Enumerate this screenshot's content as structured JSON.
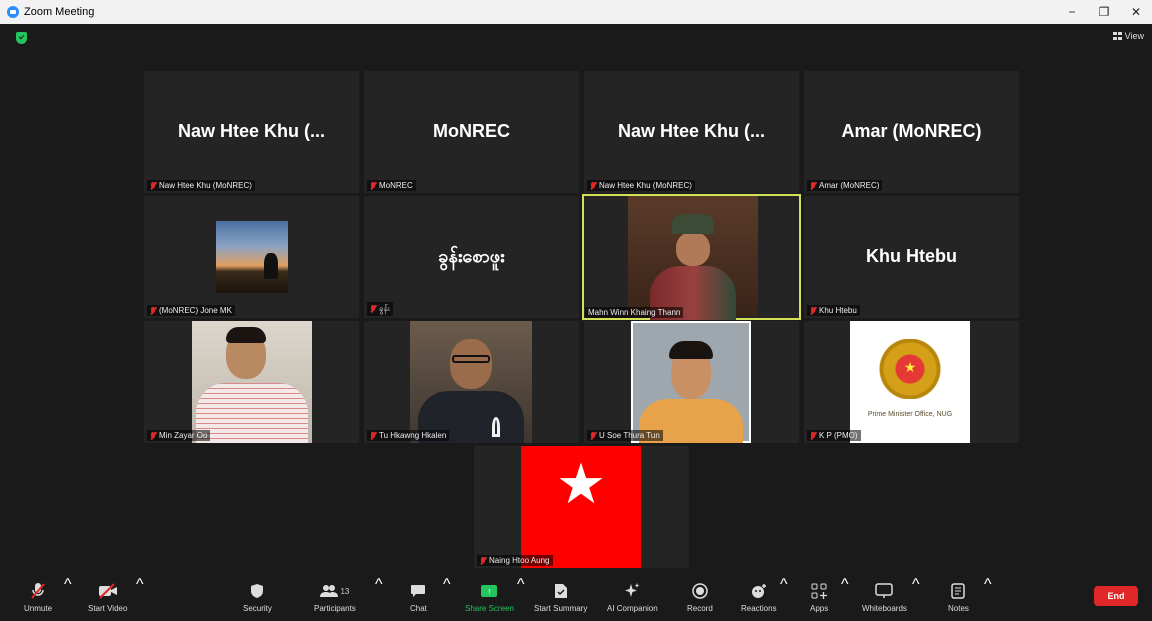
{
  "window": {
    "title": "Zoom Meeting",
    "minimize": "−",
    "restore": "❐",
    "close": "✕"
  },
  "topbar": {
    "view_label": "View"
  },
  "tiles": [
    {
      "display": "Naw Htee Khu (...",
      "label": "Naw Htee Khu (MoNREC)"
    },
    {
      "display": "MoNREC",
      "label": "MoNREC"
    },
    {
      "display": "Naw Htee Khu (...",
      "label": "Naw Htee Khu (MoNREC)"
    },
    {
      "display": "Amar (MoNREC)",
      "label": "Amar (MoNREC)"
    },
    {
      "display": "",
      "label": "(MoNREC) Jone MK"
    },
    {
      "display": "ခွန်းစောဖူး",
      "label": "ခွန်း"
    },
    {
      "display": "",
      "label": "Mahn Winn Khaing Thann"
    },
    {
      "display": "Khu Htebu",
      "label": "Khu Htebu"
    },
    {
      "display": "",
      "label": "Min Zayar Oo"
    },
    {
      "display": "",
      "label": "Tu Hkawng Hkalen"
    },
    {
      "display": "",
      "label": "U Soe Thura Tun"
    },
    {
      "display": "",
      "label": "K P (PMO)",
      "emblem_caption": "Prime Minister Office, NUG"
    },
    {
      "display": "",
      "label": "Naing Htoo Aung"
    }
  ],
  "toolbar": {
    "unmute": "Unmute",
    "start_video": "Start Video",
    "security": "Security",
    "participants": "Participants",
    "participants_count": "13",
    "chat": "Chat",
    "share_screen": "Share Screen",
    "start_summary": "Start Summary",
    "ai_companion": "AI Companion",
    "record": "Record",
    "reactions": "Reactions",
    "apps": "Apps",
    "whiteboards": "Whiteboards",
    "notes": "Notes",
    "end": "End"
  },
  "colors": {
    "accent": "#2d8cff",
    "end": "#e02828",
    "share": "#22c55e",
    "active_speaker": "#d4e157"
  }
}
